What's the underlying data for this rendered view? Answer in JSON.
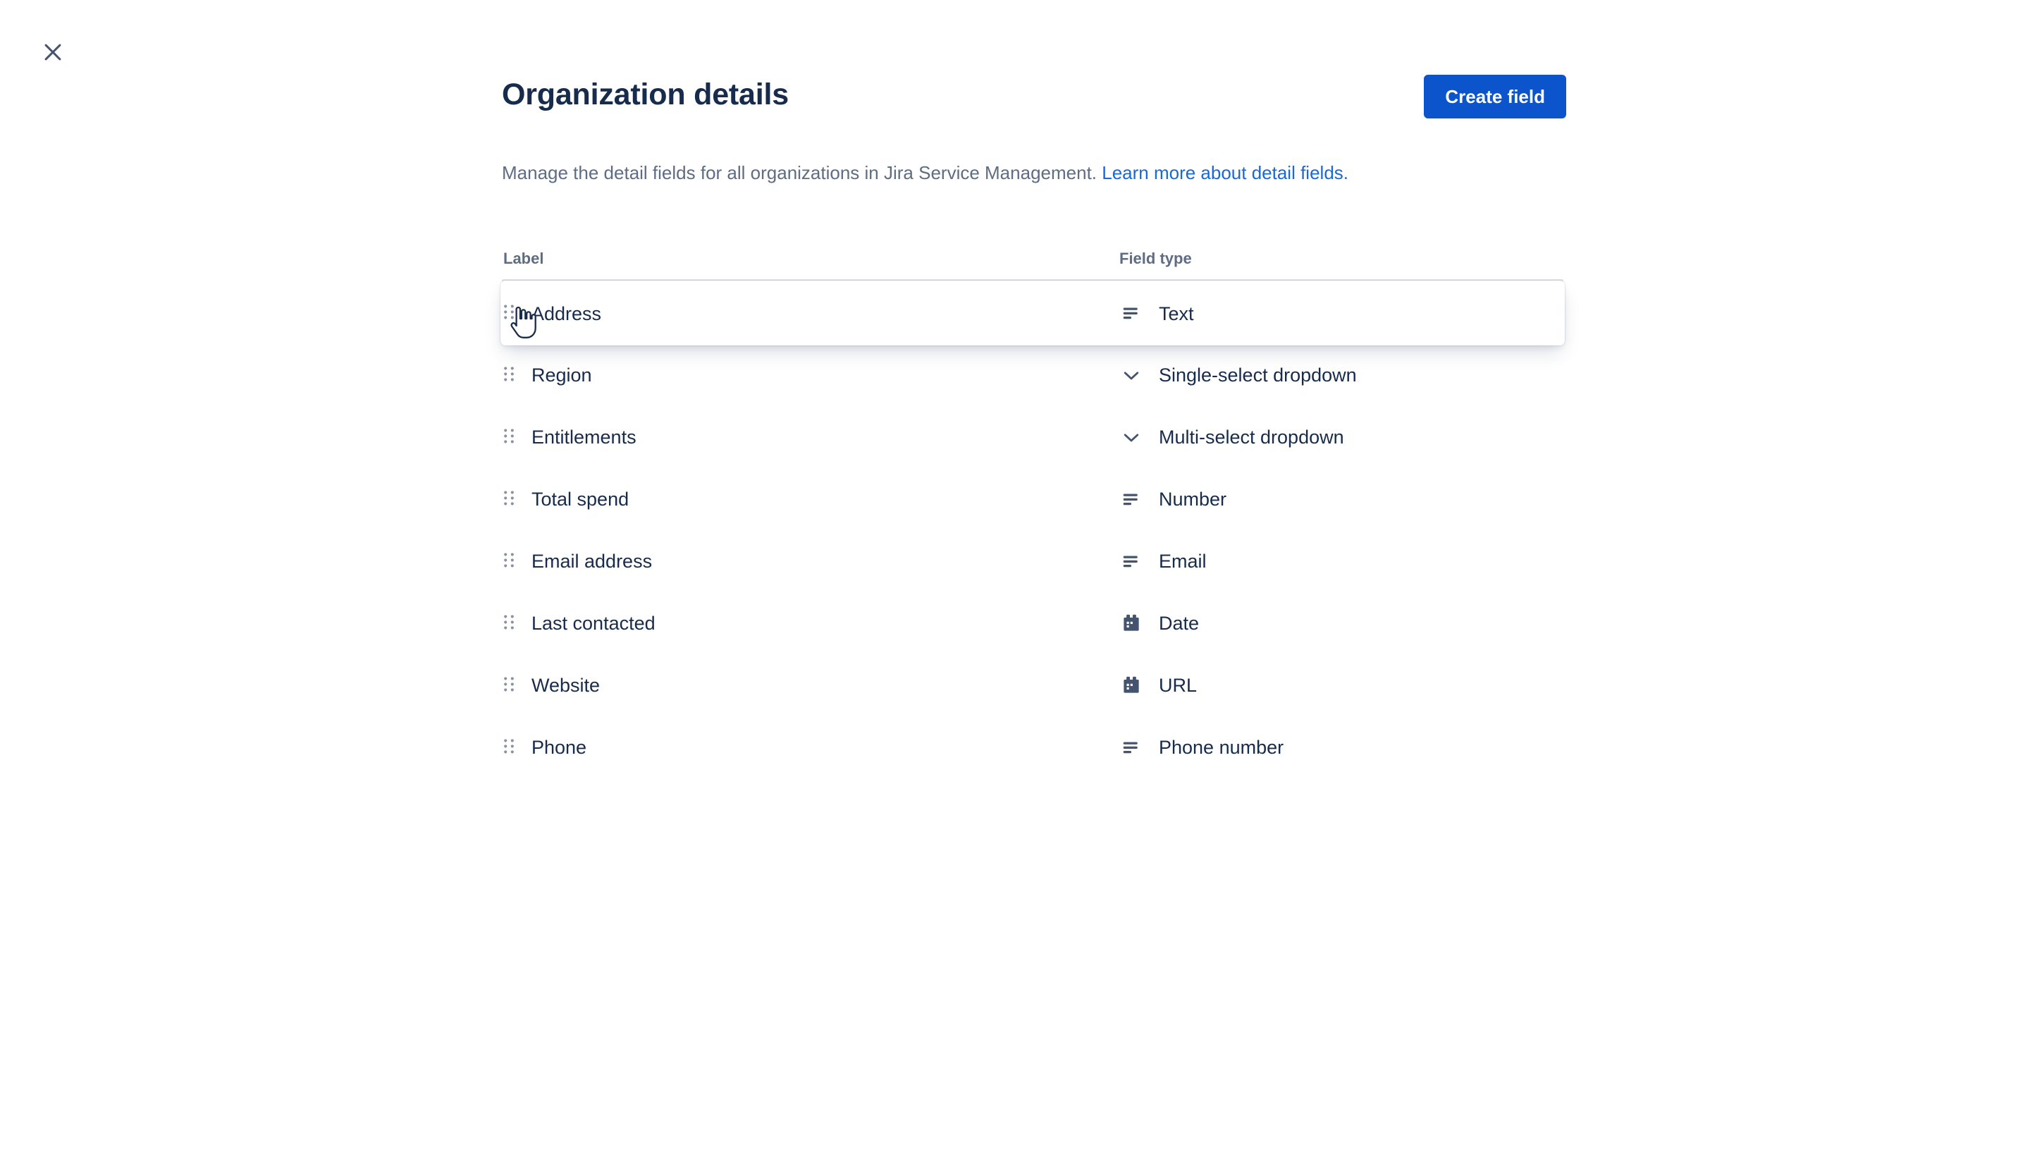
{
  "window": {
    "close_icon": "close-icon"
  },
  "header": {
    "title": "Organization details",
    "create_button": "Create field"
  },
  "description": {
    "text": "Manage the detail fields for all organizations in Jira Service Management. ",
    "link_text": "Learn more about detail fields."
  },
  "table": {
    "columns": {
      "label": "Label",
      "field_type": "Field type"
    },
    "rows": [
      {
        "label": "Address",
        "field_type": "Text",
        "icon": "text-lines-icon",
        "dragging": true
      },
      {
        "label": "Region",
        "field_type": "Single-select dropdown",
        "icon": "chevron-down-icon",
        "dragging": false
      },
      {
        "label": "Entitlements",
        "field_type": "Multi-select dropdown",
        "icon": "chevron-down-icon",
        "dragging": false
      },
      {
        "label": "Total spend",
        "field_type": "Number",
        "icon": "text-lines-icon",
        "dragging": false
      },
      {
        "label": "Email address",
        "field_type": "Email",
        "icon": "text-lines-icon",
        "dragging": false
      },
      {
        "label": "Last contacted",
        "field_type": "Date",
        "icon": "calendar-icon",
        "dragging": false
      },
      {
        "label": "Website",
        "field_type": "URL",
        "icon": "calendar-icon",
        "dragging": false
      },
      {
        "label": "Phone",
        "field_type": "Phone number",
        "icon": "text-lines-icon",
        "dragging": false
      }
    ],
    "drag_handle_icon": "drag-handle-icon"
  },
  "cursor": {
    "type": "pointing-hand-cursor"
  },
  "colors": {
    "primary_button": "#0B54CC",
    "link": "#1868DB",
    "text_primary": "#172B4D",
    "text_subtle": "#5E6C84",
    "divider": "#DFE1E6",
    "background": "#FFFFFF"
  }
}
